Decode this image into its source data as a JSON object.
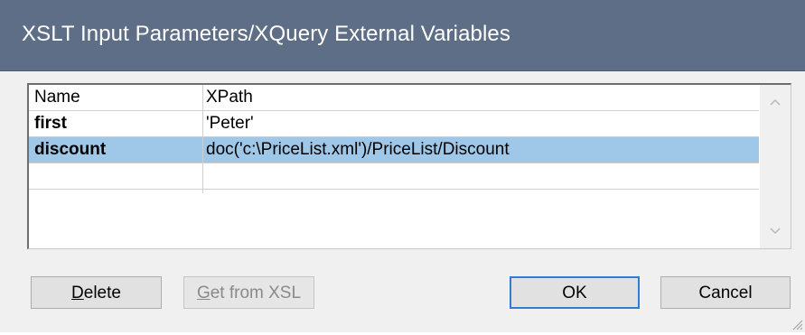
{
  "window": {
    "title": "XSLT Input Parameters/XQuery External Variables"
  },
  "grid": {
    "columns": [
      "Name",
      "XPath"
    ],
    "rows": [
      {
        "name": "first",
        "xpath": "'Peter'",
        "selected": false
      },
      {
        "name": "discount",
        "xpath": "doc('c:\\PriceList.xml')/PriceList/Discount",
        "selected": true
      },
      {
        "name": "",
        "xpath": "",
        "selected": false
      }
    ]
  },
  "buttons": {
    "delete": {
      "mnemonic": "D",
      "rest": "elete"
    },
    "get_from_xsl": {
      "mnemonic": "G",
      "rest": "et from XSL",
      "disabled": true
    },
    "ok": "OK",
    "cancel": "Cancel"
  },
  "colors": {
    "titlebar": "#5d6e86",
    "selection": "#9fc7e8",
    "default_button_border": "#2f7bd6"
  }
}
